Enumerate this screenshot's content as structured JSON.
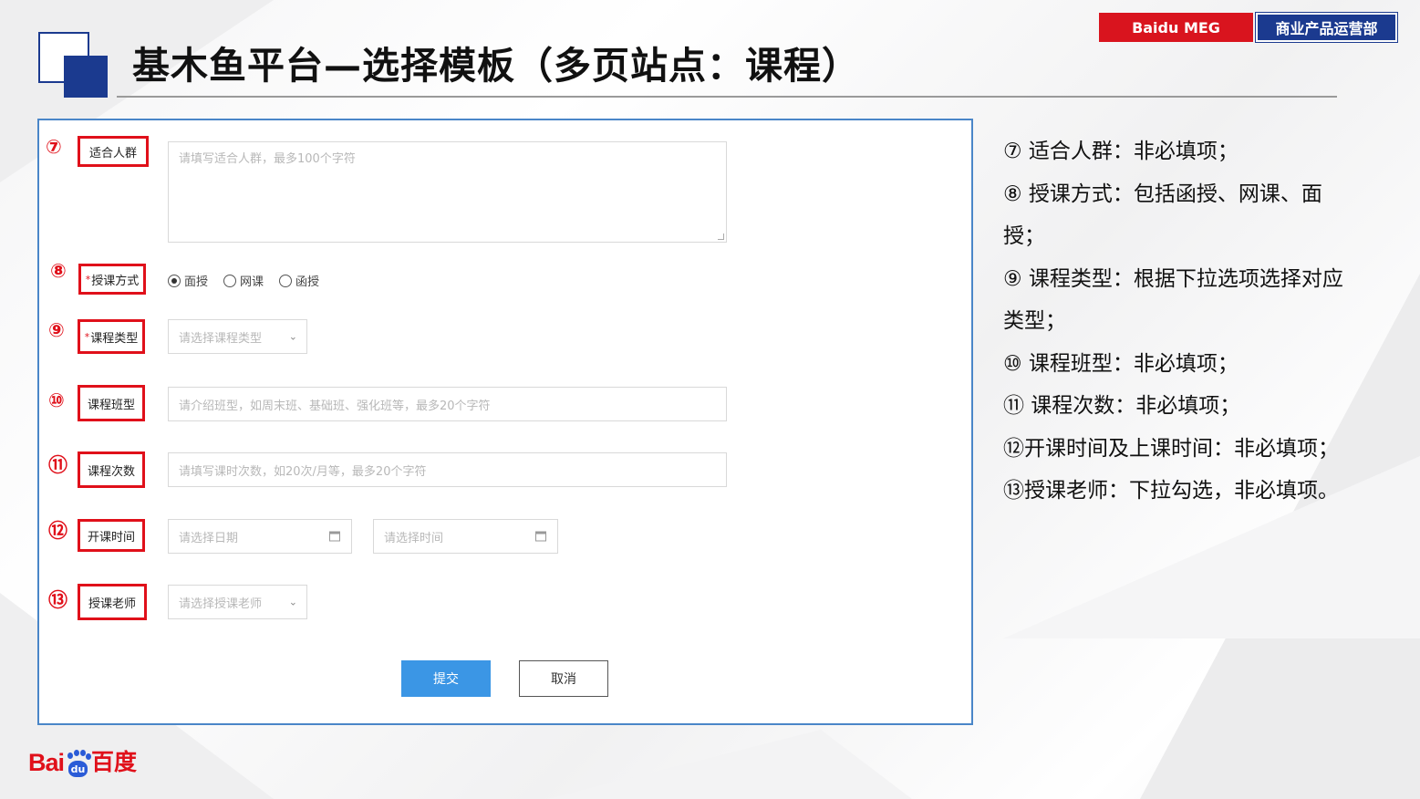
{
  "brand": {
    "tag_left": "Baidu MEG",
    "tag_right": "商业产品运营部"
  },
  "page_title": "基木鱼平台—选择模板（多页站点：课程）",
  "form": {
    "rows": [
      {
        "num": "⑦",
        "label": "适合人群",
        "required": false,
        "placeholder": "请填写适合人群，最多100个字符"
      },
      {
        "num": "⑧",
        "label": "授课方式",
        "required": true,
        "options": [
          {
            "label": "面授",
            "selected": true
          },
          {
            "label": "网课",
            "selected": false
          },
          {
            "label": "函授",
            "selected": false
          }
        ]
      },
      {
        "num": "⑨",
        "label": "课程类型",
        "required": true,
        "placeholder": "请选择课程类型"
      },
      {
        "num": "⑩",
        "label": "课程班型",
        "required": false,
        "placeholder": "请介绍班型，如周末班、基础班、强化班等，最多20个字符"
      },
      {
        "num": "⑪",
        "label": "课程次数",
        "required": false,
        "placeholder": "请填写课时次数，如20次/月等，最多20个字符"
      },
      {
        "num": "⑫",
        "label": "开课时间",
        "required": false,
        "date_placeholder": "请选择日期",
        "time_placeholder": "请选择时间"
      },
      {
        "num": "⑬",
        "label": "授课老师",
        "required": false,
        "placeholder": "请选择授课老师"
      }
    ],
    "submit_label": "提交",
    "cancel_label": "取消"
  },
  "notes": [
    "⑦ 适合人群：非必填项；",
    "⑧ 授课方式：包括函授、网课、面授；",
    "⑨ 课程类型：根据下拉选项选择对应类型；",
    "⑩ 课程班型：非必填项；",
    "⑪ 课程次数：非必填项；",
    "⑫开课时间及上课时间：非必填项；",
    "⑬授课老师：下拉勾选，非必填项。"
  ],
  "logo": {
    "left": "Bai",
    "paw": "du",
    "right": "百度"
  },
  "colors": {
    "accent_red": "#e0101a",
    "brand_blue": "#1b3a8f",
    "submit_blue": "#3b96e5",
    "panel_border": "#4a86c8"
  }
}
